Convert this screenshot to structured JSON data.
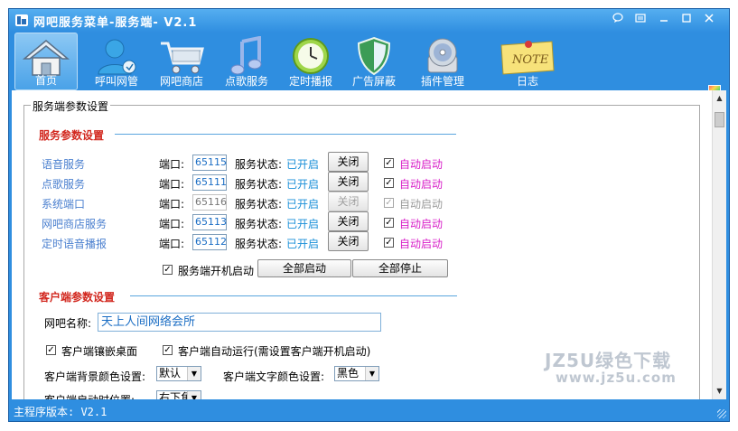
{
  "window": {
    "title": "网吧服务菜单-服务端- V2.1",
    "controls": [
      "feedback-icon",
      "menu-icon",
      "minimize-icon",
      "maximize-icon",
      "close-icon"
    ]
  },
  "toolbar": {
    "items": [
      {
        "label": "首页",
        "icon": "home-icon",
        "active": true
      },
      {
        "label": "呼叫网管",
        "icon": "user-call-icon"
      },
      {
        "label": "网吧商店",
        "icon": "cart-icon"
      },
      {
        "label": "点歌服务",
        "icon": "music-note-icon"
      },
      {
        "label": "定时播报",
        "icon": "clock-icon"
      },
      {
        "label": "广告屏蔽",
        "icon": "shield-icon"
      },
      {
        "label": "插件管理",
        "icon": "plugin-icon"
      },
      {
        "label": "日志",
        "icon": "note-icon"
      }
    ]
  },
  "group": {
    "legend": "服务端参数设置"
  },
  "server": {
    "title": "服务参数设置",
    "port_label": "端口:",
    "status_label": "服务状态:",
    "services": [
      {
        "name": "语音服务",
        "port": "65115",
        "status": "已开启",
        "button": "关闭",
        "auto_checked": true,
        "auto_label": "自动启动",
        "enabled": true
      },
      {
        "name": "点歌服务",
        "port": "65111",
        "status": "已开启",
        "button": "关闭",
        "auto_checked": true,
        "auto_label": "自动启动",
        "enabled": true
      },
      {
        "name": "系统端口",
        "port": "65116",
        "status": "已开启",
        "button": "关闭",
        "auto_checked": true,
        "auto_label": "自动启动",
        "enabled": false
      },
      {
        "name": "网吧商店服务",
        "port": "65113",
        "status": "已开启",
        "button": "关闭",
        "auto_checked": true,
        "auto_label": "自动启动",
        "enabled": true
      },
      {
        "name": "定时语音播报",
        "port": "65112",
        "status": "已开启",
        "button": "关闭",
        "auto_checked": true,
        "auto_label": "自动启动",
        "enabled": true
      }
    ],
    "boot_start_label": "服务端开机启动",
    "boot_start_checked": true,
    "start_all_label": "全部启动",
    "stop_all_label": "全部停止"
  },
  "client": {
    "title": "客户端参数设置",
    "netbar_name_label": "网吧名称:",
    "netbar_name_value": "天上人间网络会所",
    "embed_desktop_label": "客户端镶嵌桌面",
    "embed_desktop_checked": true,
    "auto_run_label": "客户端自动运行(需设置客户端开机启动)",
    "auto_run_checked": true,
    "bg_color_label": "客户端背景颜色设置:",
    "bg_color_value": "默认",
    "text_color_label": "客户端文字颜色设置:",
    "text_color_value": "黑色",
    "position_label": "客户端启动时位置:",
    "position_value": "右下角"
  },
  "statusbar": {
    "text": "主程序版本: V2.1"
  },
  "watermark": {
    "line1": "JZ5U绿色下载",
    "line2": "www.jz5u.com"
  },
  "colors": {
    "window_blue": "#2f8ee0",
    "section_red": "#d2281f",
    "service_blue": "#4a7fcf",
    "status_blue": "#1a8fd8",
    "auto_magenta": "#d81ec8"
  }
}
